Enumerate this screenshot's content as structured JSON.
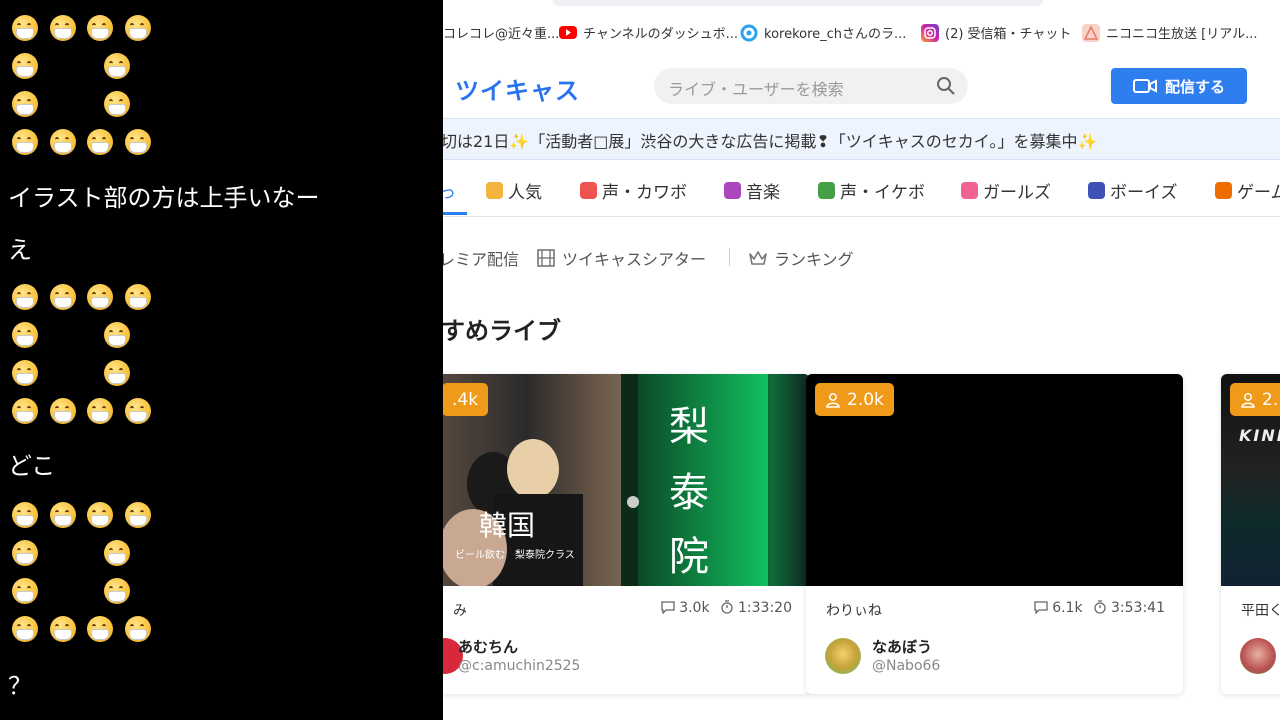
{
  "chat": {
    "messages": [
      "イラスト部の方は上手いなー",
      "え",
      "どこ",
      "？"
    ]
  },
  "bookmarks": [
    {
      "label": "コレコレ@近々重...",
      "icon": "bookmark-favicon",
      "color": "#f2a23a"
    },
    {
      "label": "チャンネルのダッシュボ...",
      "icon": "youtube-icon",
      "color": "#ff0000"
    },
    {
      "label": "korekore_chさんのラ...",
      "icon": "twitcasting-icon",
      "color": "#2aa3f0"
    },
    {
      "label": "(2) 受信箱・チャット",
      "icon": "instagram-icon",
      "color": "#d6249f"
    },
    {
      "label": "ニコニコ生放送 [リアル...",
      "icon": "niconico-icon",
      "color": "#e87a6a"
    }
  ],
  "header": {
    "logo": "ツイキャス",
    "search_placeholder": "ライブ・ユーザーを検索",
    "stream_button": "配信する",
    "accent": "#2f7ef0"
  },
  "banner": {
    "text": "切は21日✨「活動者□展」渋谷の大きな広告に掲載❢「ツイキャスのセカイ。」を募集中✨"
  },
  "categories": [
    {
      "label": "っ",
      "icon": "home-icon",
      "color": "#2f7ef0"
    },
    {
      "label": "人気",
      "icon": "crown-icon",
      "color": "#f3b33d"
    },
    {
      "label": "声・カワボ",
      "icon": "heart-icon",
      "color": "#ef5350"
    },
    {
      "label": "音楽",
      "icon": "music-note-icon",
      "color": "#ab47bc"
    },
    {
      "label": "声・イケボ",
      "icon": "mic-icon",
      "color": "#43a047"
    },
    {
      "label": "ガールズ",
      "icon": "ribbon-icon",
      "color": "#f06292"
    },
    {
      "label": "ボーイズ",
      "icon": "boys-icon",
      "color": "#3f51b5"
    },
    {
      "label": "ゲーム",
      "icon": "gamepad-icon",
      "color": "#ef6c00"
    }
  ],
  "subnav": [
    {
      "label": "レミア配信",
      "icon": "premiere-icon"
    },
    {
      "label": "ツイキャスシアター",
      "icon": "film-icon"
    },
    {
      "label": "ランキング",
      "icon": "crown-outline-icon"
    }
  ],
  "section": {
    "title": "すめライブ"
  },
  "cards": [
    {
      "viewers": ".4k",
      "title": "み",
      "comments": "3.0k",
      "duration": "1:33:20",
      "user_name": "あむちん",
      "user_id": "@c:amuchin2525",
      "thumb_text_1": "梨",
      "thumb_text_2": "泰",
      "thumb_text_3": "院",
      "thumb_text_4": "韓国",
      "thumb_text_5": "ビール飲む　梨泰院クラス"
    },
    {
      "viewers": "2.0k",
      "title": "わりぃね",
      "comments": "6.1k",
      "duration": "3:53:41",
      "user_name": "なあぼう",
      "user_id": "@Nabo66"
    },
    {
      "viewers": "2.",
      "title": "平田く",
      "thumb_text_1": "KINE"
    }
  ]
}
